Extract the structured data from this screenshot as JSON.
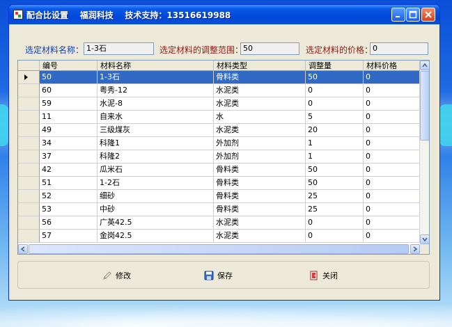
{
  "window": {
    "title": "配合比设置    福润科技    技术支持：13516619988"
  },
  "form": {
    "material_name_label": "选定材料名称：",
    "material_name_value": "1-3石",
    "range_label": "选定材料的调整范围：",
    "range_value": "50",
    "price_label": "选定材料的价格：",
    "price_value": "0"
  },
  "grid": {
    "columns": [
      "编号",
      "材料名称",
      "材料类型",
      "调整量",
      "材料价格"
    ],
    "rows": [
      [
        "50",
        "1-3石",
        "骨料类",
        "50",
        "0"
      ],
      [
        "60",
        "粤秀-12",
        "水泥类",
        "0",
        "0"
      ],
      [
        "59",
        "水泥-8",
        "水泥类",
        "0",
        "0"
      ],
      [
        "11",
        "自来水",
        "水",
        "5",
        "0"
      ],
      [
        "49",
        "三级煤灰",
        "水泥类",
        "20",
        "0"
      ],
      [
        "34",
        "科隆1",
        "外加剂",
        "1",
        "0"
      ],
      [
        "37",
        "科隆2",
        "外加剂",
        "1",
        "0"
      ],
      [
        "42",
        "瓜米石",
        "骨料类",
        "50",
        "0"
      ],
      [
        "51",
        "1-2石",
        "骨料类",
        "50",
        "0"
      ],
      [
        "52",
        "细砂",
        "骨料类",
        "25",
        "0"
      ],
      [
        "53",
        "中砂",
        "骨料类",
        "25",
        "0"
      ],
      [
        "56",
        "广英42.5",
        "水泥类",
        "0",
        "0"
      ],
      [
        "57",
        "金岗42.5",
        "水泥类",
        "0",
        "0"
      ]
    ],
    "selected_row": 0
  },
  "buttons": {
    "edit_label": "修改",
    "save_label": "保存",
    "close_label": "关闭"
  },
  "icons": [
    "app-icon",
    "minimize-icon",
    "maximize-icon",
    "close-icon",
    "edit-icon",
    "save-icon",
    "close-app-icon"
  ],
  "colors": {
    "titlebar": "#0a4fd6",
    "selection": "#316ac5",
    "label_blue": "#1540b8",
    "label_red": "#8b1a1a"
  }
}
